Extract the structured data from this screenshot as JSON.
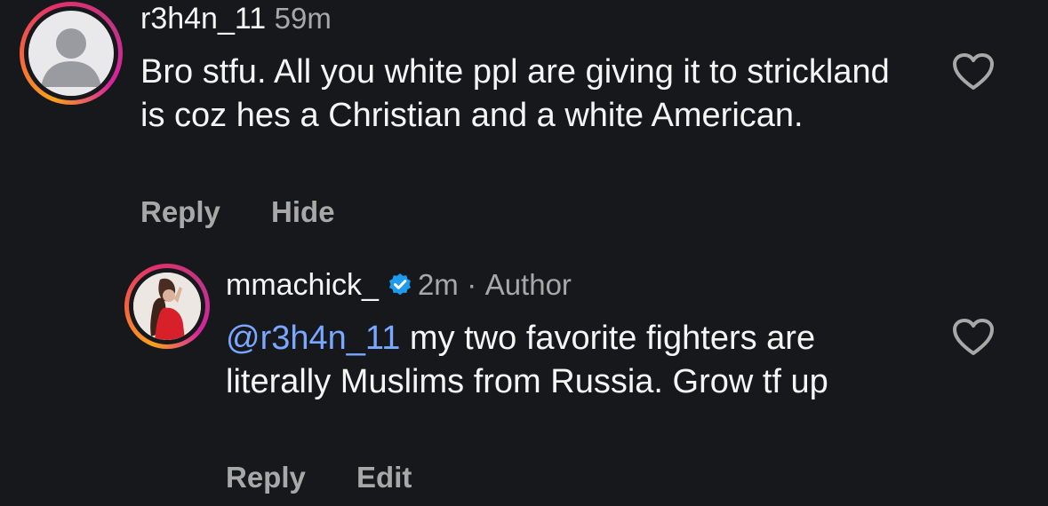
{
  "comments": [
    {
      "username": "r3h4n_11",
      "time": "59m",
      "text": "Bro stfu. All you white ppl are giving it to strickland is coz hes a Christian and a white American.",
      "actions": [
        "Reply",
        "Hide"
      ],
      "avatar": "default-avatar-icon",
      "liked": false
    },
    {
      "username": "mmachick_",
      "verified": true,
      "time": "2m",
      "separator": "·",
      "author_label": "Author",
      "mention": "@r3h4n_11",
      "text": " my two favorite fighters are literally Muslims from Russia. Grow tf up",
      "actions": [
        "Reply",
        "Edit"
      ],
      "avatar": "profile-photo",
      "liked": false
    }
  ],
  "colors": {
    "background": "#16181c",
    "text": "#f5f5f5",
    "muted": "#a8a8a8",
    "mention": "#7aa7ff",
    "verified": "#1d9bf0"
  }
}
